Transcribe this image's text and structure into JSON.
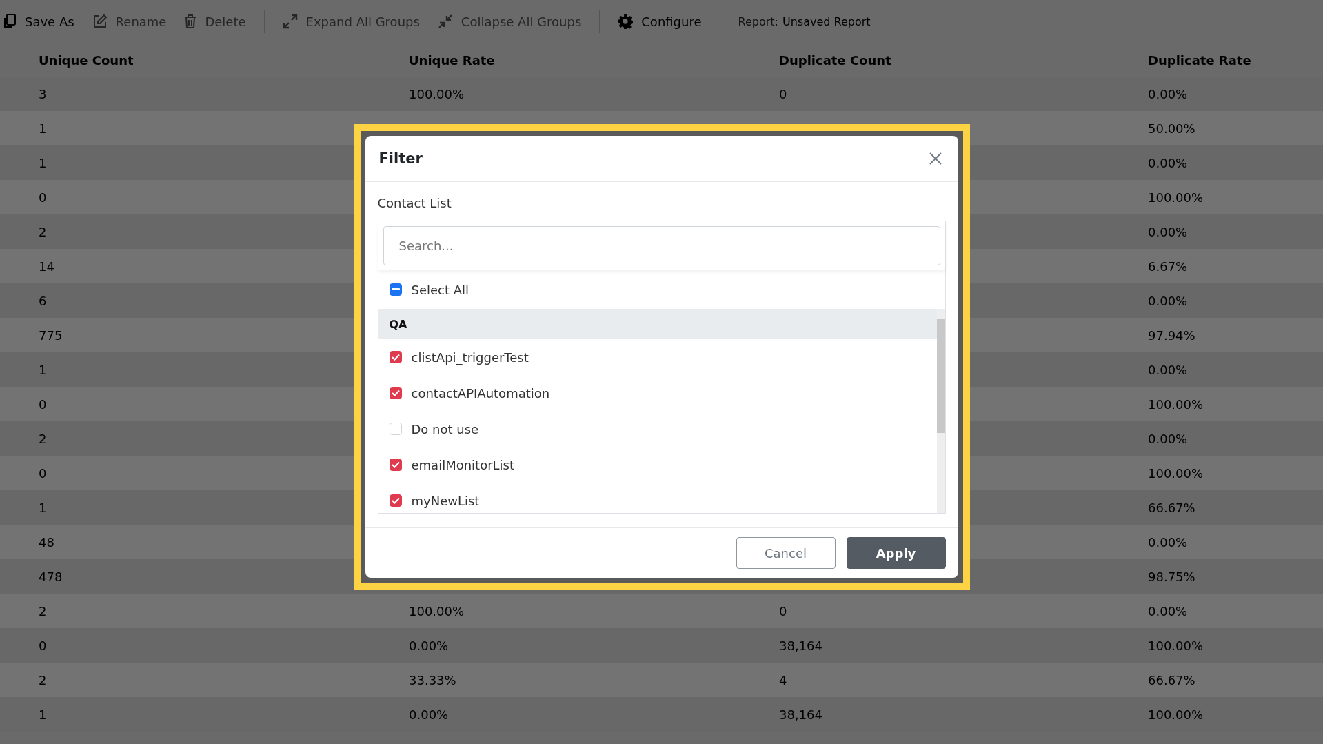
{
  "toolbar": {
    "items": [
      {
        "label": "Save As",
        "disabled": false
      },
      {
        "label": "Rename",
        "disabled": true
      },
      {
        "label": "Delete",
        "disabled": true
      },
      {
        "label": "Expand All Groups",
        "disabled": true
      },
      {
        "label": "Collapse All Groups",
        "disabled": true
      },
      {
        "label": "Configure",
        "disabled": false
      }
    ],
    "report_label": "Report:",
    "report_name": "Unsaved Report"
  },
  "table": {
    "columns": [
      "Unique Count",
      "Unique Rate",
      "Duplicate Count",
      "Duplicate Rate"
    ],
    "rows": [
      [
        "3",
        "100.00%",
        "0",
        "0.00%"
      ],
      [
        "1",
        "",
        "",
        "50.00%"
      ],
      [
        "1",
        "",
        "",
        "0.00%"
      ],
      [
        "0",
        "",
        "",
        "100.00%"
      ],
      [
        "2",
        "",
        "",
        "0.00%"
      ],
      [
        "14",
        "",
        "",
        "6.67%"
      ],
      [
        "6",
        "",
        "",
        "0.00%"
      ],
      [
        "775",
        "",
        "",
        "97.94%"
      ],
      [
        "1",
        "",
        "",
        "0.00%"
      ],
      [
        "0",
        "",
        "",
        "100.00%"
      ],
      [
        "2",
        "",
        "",
        "0.00%"
      ],
      [
        "0",
        "",
        "",
        "100.00%"
      ],
      [
        "1",
        "",
        "",
        "66.67%"
      ],
      [
        "48",
        "",
        "",
        "0.00%"
      ],
      [
        "478",
        "",
        "",
        "98.75%"
      ],
      [
        "2",
        "100.00%",
        "0",
        "0.00%"
      ],
      [
        "0",
        "0.00%",
        "38,164",
        "100.00%"
      ],
      [
        "2",
        "33.33%",
        "4",
        "66.67%"
      ],
      [
        "1",
        "0.00%",
        "38,164",
        "100.00%"
      ]
    ]
  },
  "dialog": {
    "title": "Filter",
    "field_label": "Contact List",
    "search": {
      "placeholder": "Search..."
    },
    "select_all": {
      "label": "Select All",
      "indeterminate": true
    },
    "groups": [
      {
        "label": "QA",
        "items": [
          {
            "label": "clistApi_triggerTest",
            "checked": true
          },
          {
            "label": "contactAPIAutomation",
            "checked": true
          },
          {
            "label": "Do not use",
            "checked": false
          },
          {
            "label": "emailMonitorList",
            "checked": true
          },
          {
            "label": "myNewList",
            "checked": true
          }
        ]
      }
    ],
    "buttons": [
      {
        "label": "Cancel",
        "kind": "secondary"
      },
      {
        "label": "Apply",
        "kind": "primary"
      }
    ]
  }
}
